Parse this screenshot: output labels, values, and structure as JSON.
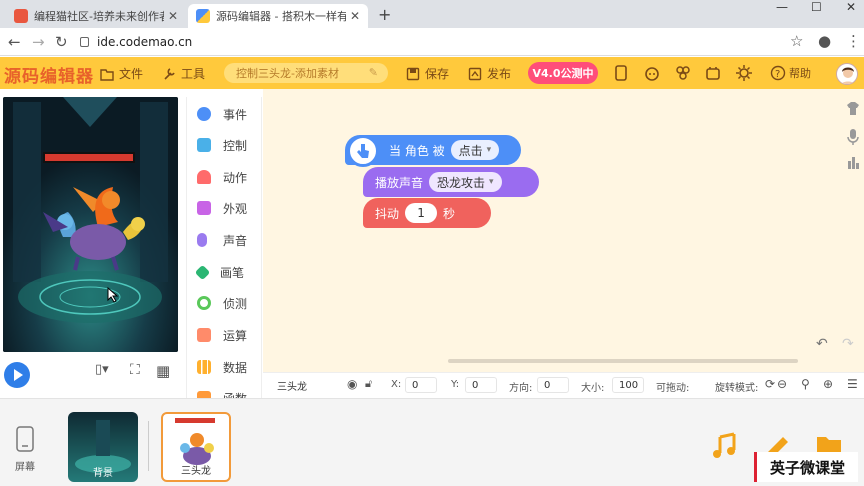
{
  "browser": {
    "tabs": [
      {
        "title": "编程猫社区-培养未来创作者 - 官",
        "active": false
      },
      {
        "title": "源码编辑器 - 搭积木一样有趣的",
        "active": true
      }
    ],
    "url": "ide.codemao.cn"
  },
  "header": {
    "logo": "源码编辑器",
    "file_label": "文件",
    "tools_label": "工具",
    "search_placeholder": "控制三头龙-添加素材",
    "save_label": "保存",
    "publish_label": "发布",
    "version_label": "V4.0公测中",
    "help_label": "帮助"
  },
  "categories": [
    {
      "label": "事件",
      "color": "#4d8ff7"
    },
    {
      "label": "控制",
      "color": "#4ab0e8"
    },
    {
      "label": "动作",
      "color": "#ff6b6b"
    },
    {
      "label": "外观",
      "color": "#c864e6"
    },
    {
      "label": "声音",
      "color": "#9a7bef"
    },
    {
      "label": "画笔",
      "color": "#2bb673"
    },
    {
      "label": "侦测",
      "color": "#5ac85a"
    },
    {
      "label": "运算",
      "color": "#ff8b6a"
    },
    {
      "label": "数据",
      "color": "#ffb02e"
    },
    {
      "label": "函数",
      "color": "#ff9a3a"
    }
  ],
  "script": {
    "event_block": {
      "text": "当 角色 被",
      "option": "点击",
      "color": "#4d8ff7"
    },
    "sound_block": {
      "text": "播放声音",
      "option": "恐龙攻击",
      "color": "#9a6cf0"
    },
    "shake_block": {
      "text": "抖动",
      "value": "1",
      "unit": "秒",
      "color": "#f0625d"
    }
  },
  "props": {
    "sprite_name": "三头龙",
    "x_label": "X:",
    "x_value": "0",
    "y_label": "Y:",
    "y_value": "0",
    "direction_label": "方向:",
    "direction_value": "0",
    "size_label": "大小:",
    "size_value": "100",
    "draggable_label": "可拖动:",
    "rotation_label": "旋转模式:"
  },
  "tray": {
    "screen_label": "屏幕",
    "background_label": "背景",
    "sprite_label": "三头龙"
  },
  "watermark": "英子微课堂"
}
